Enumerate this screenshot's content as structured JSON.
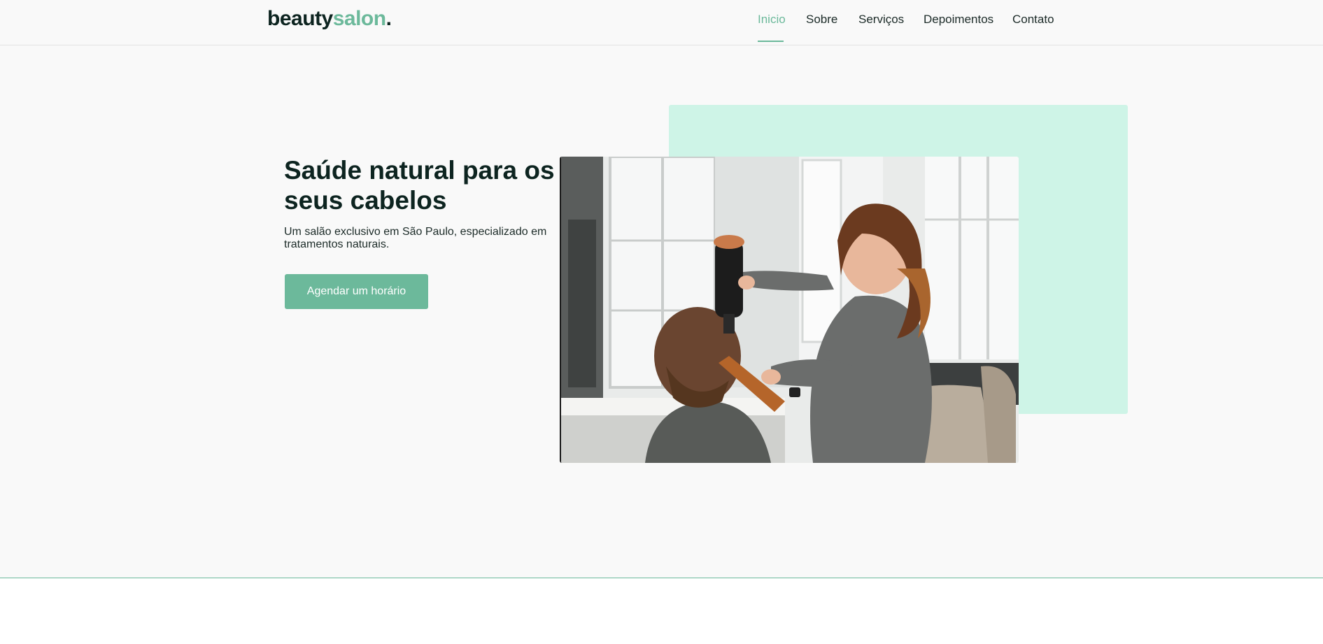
{
  "brand": {
    "name_part1": "beauty",
    "name_part2": "salon",
    "name_dot": "."
  },
  "nav": {
    "items": [
      {
        "label": "Inicio",
        "active": true
      },
      {
        "label": "Sobre",
        "active": false
      },
      {
        "label": "Serviços",
        "active": false
      },
      {
        "label": "Depoimentos",
        "active": false
      },
      {
        "label": "Contato",
        "active": false
      }
    ]
  },
  "hero": {
    "title": "Saúde natural para os seus cabelos",
    "subtitle": "Um salão exclusivo em São Paulo, especializado em tratamentos naturais.",
    "cta_label": "Agendar um horário",
    "image_subject": "hairdresser-blow-drying-client-photo"
  },
  "colors": {
    "accent": "#6cb99b",
    "accent_light": "#cef4e7",
    "text_dark": "#0d2420",
    "background": "#f9f9f9"
  }
}
